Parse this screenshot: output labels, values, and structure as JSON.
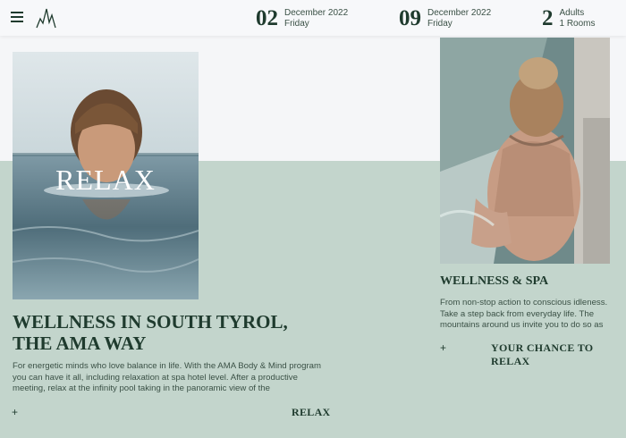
{
  "header": {
    "arrival": {
      "day": "02",
      "month": "December 2022",
      "weekday": "Friday"
    },
    "departure": {
      "day": "09",
      "month": "December 2022",
      "weekday": "Friday"
    },
    "guests": {
      "count": "2",
      "adults": "Adults",
      "rooms": "1 Rooms"
    }
  },
  "hero": {
    "image_overlay": "RELAX",
    "title": "WELLNESS IN SOUTH TYROL, THE AMA WAY",
    "text": "For energetic minds who love balance in life. With the AMA Body & Mind program you can have it all, including relaxation at spa hotel level. After a productive meeting, relax at the infinity pool taking in the panoramic view of the",
    "plus": "+",
    "link": "RELAX"
  },
  "side": {
    "title": "WELLNESS & SPA",
    "text": "From non-stop action to conscious idleness. Take a step back from everyday life. The mountains around us invite you to do so as",
    "plus": "+",
    "link": "YOUR CHANCE TO RELAX"
  },
  "colors": {
    "brand": "#1f3b2e",
    "band": "#c3d5cc",
    "background": "#f5f6f8"
  },
  "icons": {
    "menu": "hamburger-menu-icon",
    "logo": "mountain-logo-icon"
  }
}
